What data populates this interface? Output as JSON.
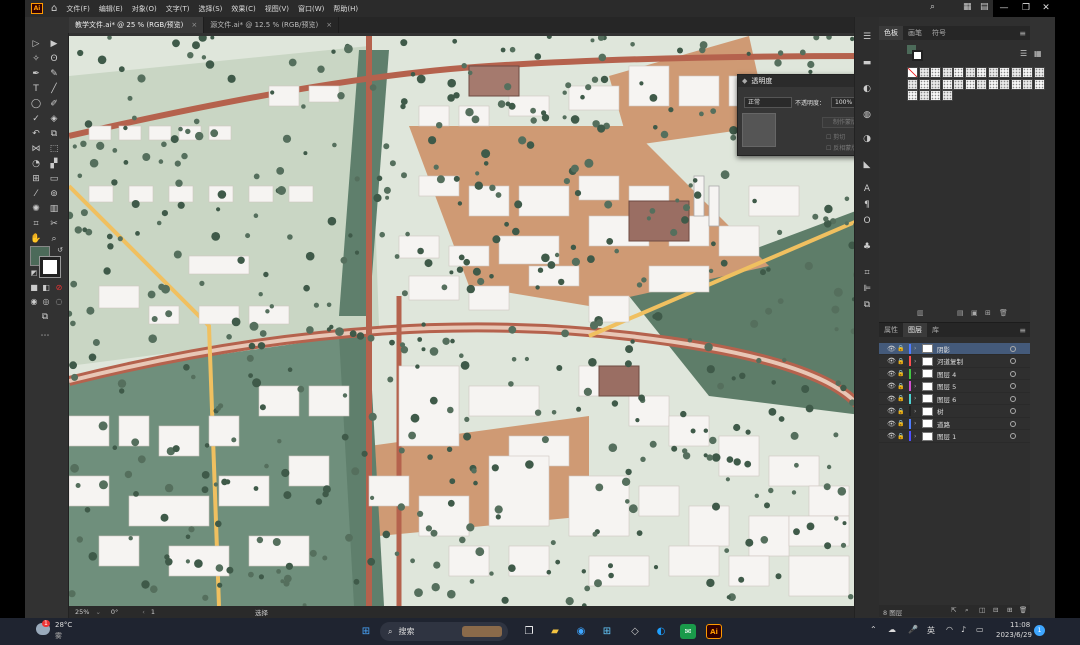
{
  "app": {
    "logo": "Ai"
  },
  "menu": [
    "文件(F)",
    "编辑(E)",
    "对象(O)",
    "文字(T)",
    "选择(S)",
    "效果(C)",
    "视图(V)",
    "窗口(W)",
    "帮助(H)"
  ],
  "window_controls": {
    "minimize": "—",
    "maximize": "❐",
    "close": "✕"
  },
  "tabs": [
    {
      "label": "教学文件.ai* @ 25 % (RGB/预览)",
      "close": "×"
    },
    {
      "label": "源文件.ai* @ 12.5 % (RGB/预览)",
      "close": "×"
    }
  ],
  "statusbar": {
    "zoom": "25%",
    "rotation": "0°",
    "artboard": "1",
    "tool": "选择"
  },
  "swatches_panel": {
    "tabs": [
      "色板",
      "画笔",
      "符号"
    ]
  },
  "transparency_panel": {
    "title": "透明度",
    "blend_mode": "正常",
    "opacity_label": "不透明度：",
    "opacity_value": "100%",
    "make_mask": "制作蒙版",
    "clip": "剪切",
    "invert_mask": "反相蒙版"
  },
  "layers_panel": {
    "tabs": [
      "属性",
      "图层",
      "库"
    ],
    "layers": [
      {
        "name": "阴影",
        "color": "#4f7cff",
        "selected": true
      },
      {
        "name": "河道复制",
        "color": "#ff4f4f",
        "selected": false
      },
      {
        "name": "图层 4",
        "color": "#43c843",
        "selected": false
      },
      {
        "name": "图层 5",
        "color": "#d24fd2",
        "selected": false
      },
      {
        "name": "图层 6",
        "color": "#4fd2d2",
        "selected": false
      },
      {
        "name": "树",
        "color": "#222222",
        "selected": false
      },
      {
        "name": "道路",
        "color": "#4f7cff",
        "selected": false
      },
      {
        "name": "图层 1",
        "color": "#4f4fff",
        "selected": false
      }
    ],
    "count": "8 图层"
  },
  "taskbar": {
    "weather_temp": "28°C",
    "weather_desc": "雾",
    "weather_badge": "1",
    "search_placeholder": "搜索",
    "ime": "英",
    "time": "11:08",
    "date": "2023/6/29",
    "notification_count": "1"
  },
  "colors": {
    "ui_bg": "#323232",
    "accent": "#ff9a00",
    "road": "#b5624d",
    "plot": "#cf9a74",
    "park": "#7a9a88",
    "building": "#f6f4f2"
  }
}
